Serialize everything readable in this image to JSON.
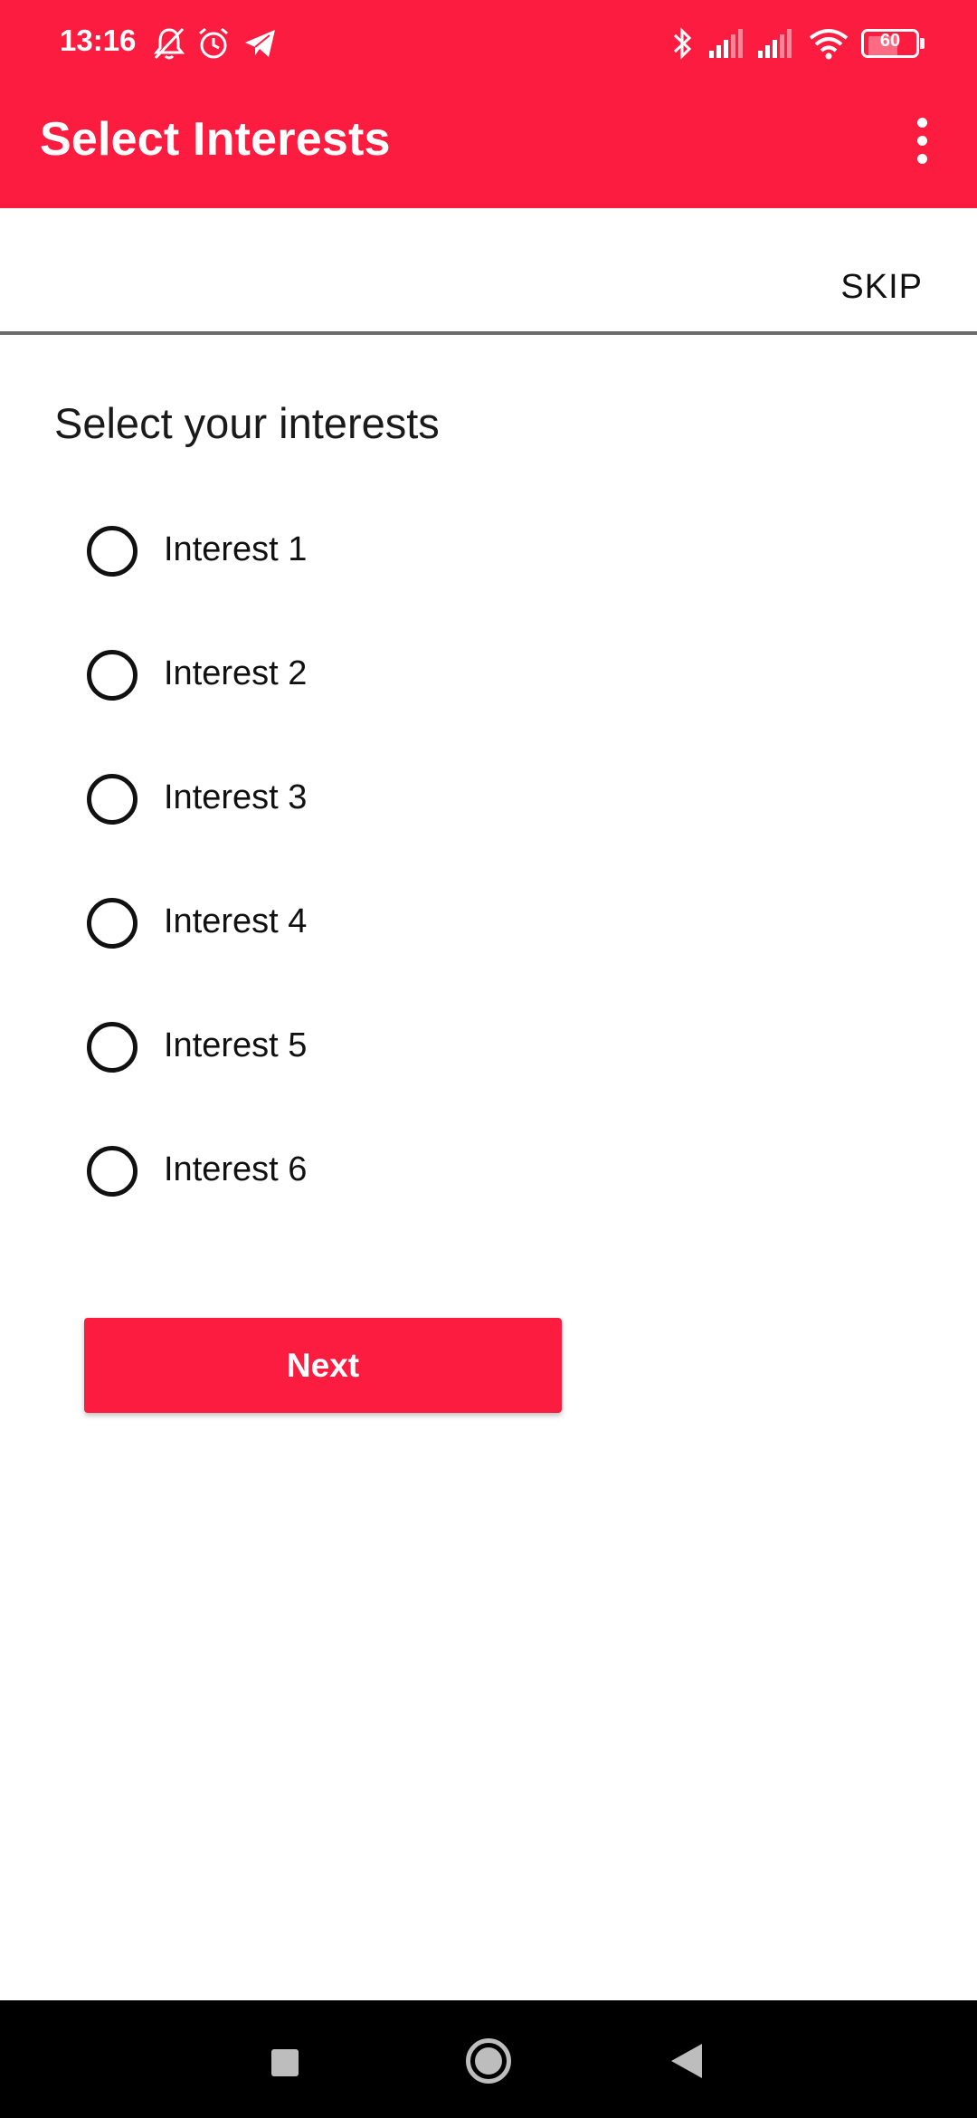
{
  "status_bar": {
    "time": "13:16",
    "left_icons": [
      "bell-off-icon",
      "alarm-icon",
      "telegram-icon"
    ],
    "right_icons": [
      "bluetooth-icon",
      "signal-1-icon",
      "signal-2-icon",
      "wifi-icon"
    ],
    "battery_level": "60"
  },
  "app_bar": {
    "title": "Select Interests",
    "menu_icon": "more-vert-icon",
    "background_color": "#fc1c40"
  },
  "skip": {
    "label": "SKIP"
  },
  "main": {
    "heading": "Select your interests",
    "options": [
      {
        "label": "Interest 1",
        "selected": false
      },
      {
        "label": "Interest 2",
        "selected": false
      },
      {
        "label": "Interest 3",
        "selected": false
      },
      {
        "label": "Interest 4",
        "selected": false
      },
      {
        "label": "Interest 5",
        "selected": false
      },
      {
        "label": "Interest 6",
        "selected": false
      }
    ],
    "next_label": "Next",
    "accent_color": "#fc1c40"
  },
  "nav_bar": {
    "icons": [
      "recents-icon",
      "home-icon",
      "back-icon"
    ]
  }
}
